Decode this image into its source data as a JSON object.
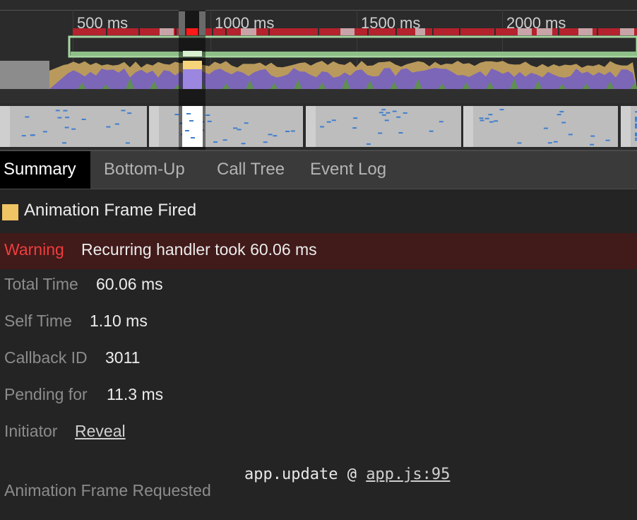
{
  "timeline": {
    "ticks": [
      "500 ms",
      "1000 ms",
      "1500 ms",
      "2000 ms"
    ],
    "colors": {
      "long_task": "#b3222d",
      "idle_block": "#c8a4a8",
      "selected_task": "#ff1a1a",
      "frames_bar": "#a7d7a0",
      "scripting": "#b99a5c",
      "rendering": "#7c66b8",
      "painting": "#5f8f52",
      "selection": "#f6d47a"
    }
  },
  "tabs": [
    {
      "label": "Summary",
      "active": true
    },
    {
      "label": "Bottom-Up",
      "active": false
    },
    {
      "label": "Call Tree",
      "active": false
    },
    {
      "label": "Event Log",
      "active": false
    }
  ],
  "summary": {
    "event_title": "Animation Frame Fired",
    "swatch_color": "#efc465",
    "warning_label": "Warning",
    "warning_text": "Recurring handler took 60.06 ms",
    "rows": {
      "total_time": {
        "label": "Total Time",
        "value": "60.06 ms"
      },
      "self_time": {
        "label": "Self Time",
        "value": "1.10 ms"
      },
      "callback_id": {
        "label": "Callback ID",
        "value": "3011"
      },
      "pending_for": {
        "label": "Pending for",
        "value": "11.3 ms"
      },
      "initiator": {
        "label": "Initiator",
        "value": "Reveal"
      }
    },
    "requested": {
      "label": "Animation Frame Requested",
      "function": "app.update @ ",
      "location": "app.js:95"
    }
  }
}
